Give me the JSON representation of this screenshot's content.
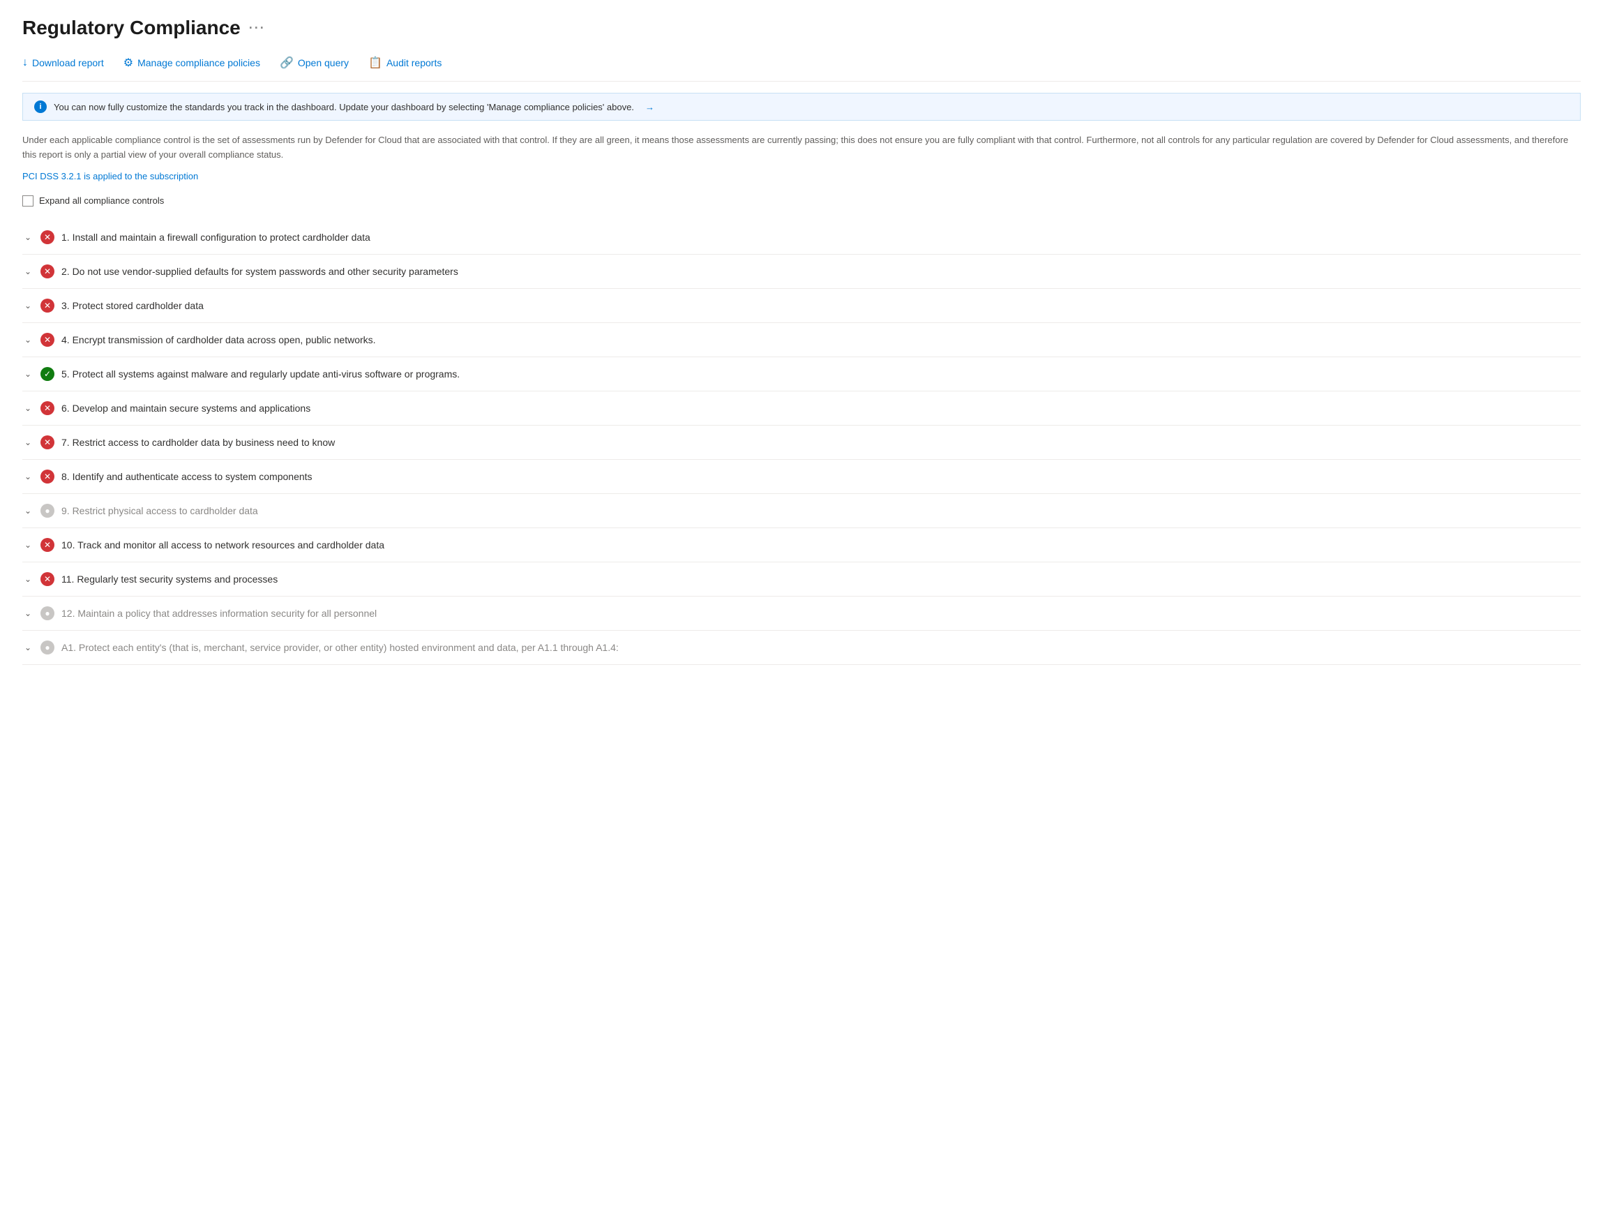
{
  "page": {
    "title": "Regulatory Compliance",
    "ellipsis": "···"
  },
  "toolbar": {
    "download_label": "Download report",
    "manage_label": "Manage compliance policies",
    "query_label": "Open query",
    "audit_label": "Audit reports"
  },
  "banner": {
    "text": "You can now fully customize the standards you track in the dashboard. Update your dashboard by selecting 'Manage compliance policies' above.",
    "arrow": "→"
  },
  "description": "Under each applicable compliance control is the set of assessments run by Defender for Cloud that are associated with that control. If they are all green, it means those assessments are currently passing; this does not ensure you are fully compliant with that control. Furthermore, not all controls for any particular regulation are covered by Defender for Cloud assessments, and therefore this report is only a partial view of your overall compliance status.",
  "subscription_link": "PCI DSS 3.2.1 is applied to the subscription",
  "expand_all_label": "Expand all compliance controls",
  "items": [
    {
      "id": 1,
      "status": "error",
      "label": "1. Install and maintain a firewall configuration to protect cardholder data",
      "grayed": false
    },
    {
      "id": 2,
      "status": "error",
      "label": "2. Do not use vendor-supplied defaults for system passwords and other security parameters",
      "grayed": false
    },
    {
      "id": 3,
      "status": "error",
      "label": "3. Protect stored cardholder data",
      "grayed": false
    },
    {
      "id": 4,
      "status": "error",
      "label": "4. Encrypt transmission of cardholder data across open, public networks.",
      "grayed": false
    },
    {
      "id": 5,
      "status": "success",
      "label": "5. Protect all systems against malware and regularly update anti-virus software or programs.",
      "grayed": false
    },
    {
      "id": 6,
      "status": "error",
      "label": "6. Develop and maintain secure systems and applications",
      "grayed": false
    },
    {
      "id": 7,
      "status": "error",
      "label": "7. Restrict access to cardholder data by business need to know",
      "grayed": false
    },
    {
      "id": 8,
      "status": "error",
      "label": "8. Identify and authenticate access to system components",
      "grayed": false
    },
    {
      "id": 9,
      "status": "gray",
      "label": "9. Restrict physical access to cardholder data",
      "grayed": true
    },
    {
      "id": 10,
      "status": "error",
      "label": "10. Track and monitor all access to network resources and cardholder data",
      "grayed": false
    },
    {
      "id": 11,
      "status": "error",
      "label": "11. Regularly test security systems and processes",
      "grayed": false
    },
    {
      "id": 12,
      "status": "gray",
      "label": "12. Maintain a policy that addresses information security for all personnel",
      "grayed": true
    },
    {
      "id": 13,
      "status": "gray",
      "label": "A1. Protect each entity's (that is, merchant, service provider, or other entity) hosted environment and data, per A1.1 through A1.4:",
      "grayed": true
    }
  ]
}
